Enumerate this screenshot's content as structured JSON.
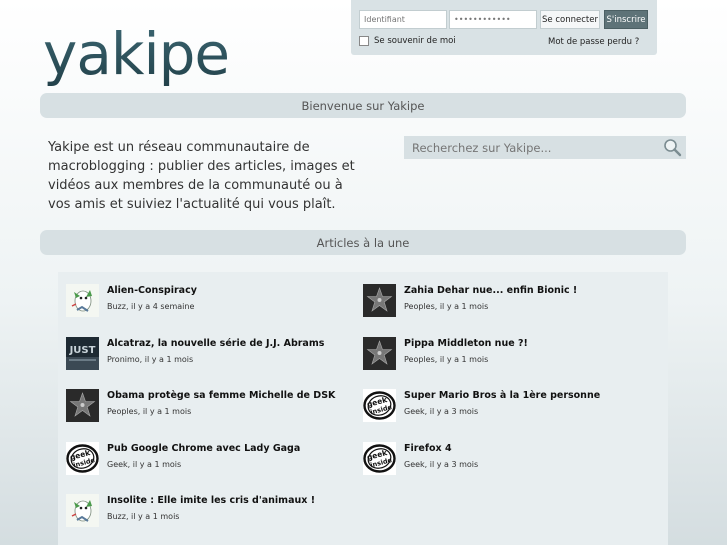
{
  "logo": "yakipe",
  "login": {
    "username_placeholder": "Identifiant",
    "password_value": "••••••••••••",
    "connect_label": "Se connecter",
    "register_label": "S'inscrire",
    "remember_label": "Se souvenir de moi",
    "forgot_label": "Mot de passe perdu ?"
  },
  "welcome": "Bienvenue sur Yakipe",
  "intro": "Yakipe est un réseau communautaire de macroblogging : publier des articles, images et vidéos aux membres de la communauté ou à vos amis et suiviez l'actualité qui vous plaît.",
  "search": {
    "placeholder": "Recherchez sur Yakipe..."
  },
  "articles_heading": "Articles à la une",
  "articles": [
    {
      "title": "Alien-Conspiracy",
      "meta": "Buzz, il y a 4 semaine",
      "thumb": "bird"
    },
    {
      "title": "Zahia Dehar nue... enfin Bionic !",
      "meta": "Peoples, il y a 1 mois",
      "thumb": "star"
    },
    {
      "title": "Alcatraz, la nouvelle série de J.J. Abrams",
      "meta": "Pronimo, il y a 1 mois",
      "thumb": "photo"
    },
    {
      "title": "Pippa Middleton nue ?!",
      "meta": "Peoples, il y a 1 mois",
      "thumb": "star"
    },
    {
      "title": "Obama protège sa femme Michelle de DSK",
      "meta": "Peoples, il y a 1 mois",
      "thumb": "star"
    },
    {
      "title": "Super Mario Bros à la 1ère personne",
      "meta": "Geek, il y a 3 mois",
      "thumb": "geek"
    },
    {
      "title": "Pub Google Chrome avec Lady Gaga",
      "meta": "Geek, il y a 1 mois",
      "thumb": "geek"
    },
    {
      "title": "Firefox 4",
      "meta": "Geek, il y a 3 mois",
      "thumb": "geek"
    },
    {
      "title": "Insolite : Elle imite les cris d'animaux !",
      "meta": "Buzz, il y a 1 mois",
      "thumb": "bird"
    }
  ],
  "colors": {
    "logo": "#2f5560",
    "band": "#d7e0e3",
    "register_button": "#5e7378"
  }
}
